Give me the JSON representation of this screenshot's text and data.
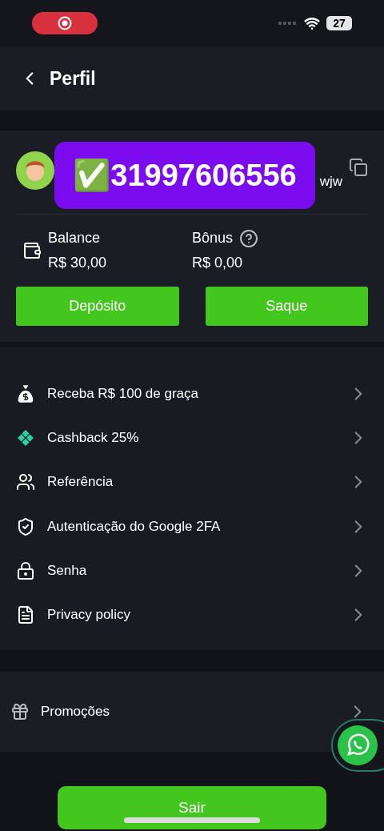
{
  "status_bar": {
    "battery": "27"
  },
  "header": {
    "title": "Perfil"
  },
  "profile": {
    "badge": "✅31997606556",
    "username_fragment": "wjw"
  },
  "balances": [
    {
      "label": "Balance",
      "amount": "R$ 30,00",
      "kind": "wallet"
    },
    {
      "label": "Bônus",
      "amount": "R$ 0,00",
      "kind": "help"
    }
  ],
  "actions": [
    "Depósito",
    "Saque"
  ],
  "menu": [
    {
      "label": "Receba R$ 100 de graça",
      "kind": "moneybag"
    },
    {
      "label": "Cashback 25%",
      "kind": "cashback"
    },
    {
      "label": "Referência",
      "kind": "users"
    },
    {
      "label": "Autenticação do Google 2FA",
      "kind": "shield"
    },
    {
      "label": "Senha",
      "kind": "lock"
    },
    {
      "label": "Privacy policy",
      "kind": "policy"
    }
  ],
  "promotions": {
    "label": "Promoções"
  },
  "logout": "Sair"
}
